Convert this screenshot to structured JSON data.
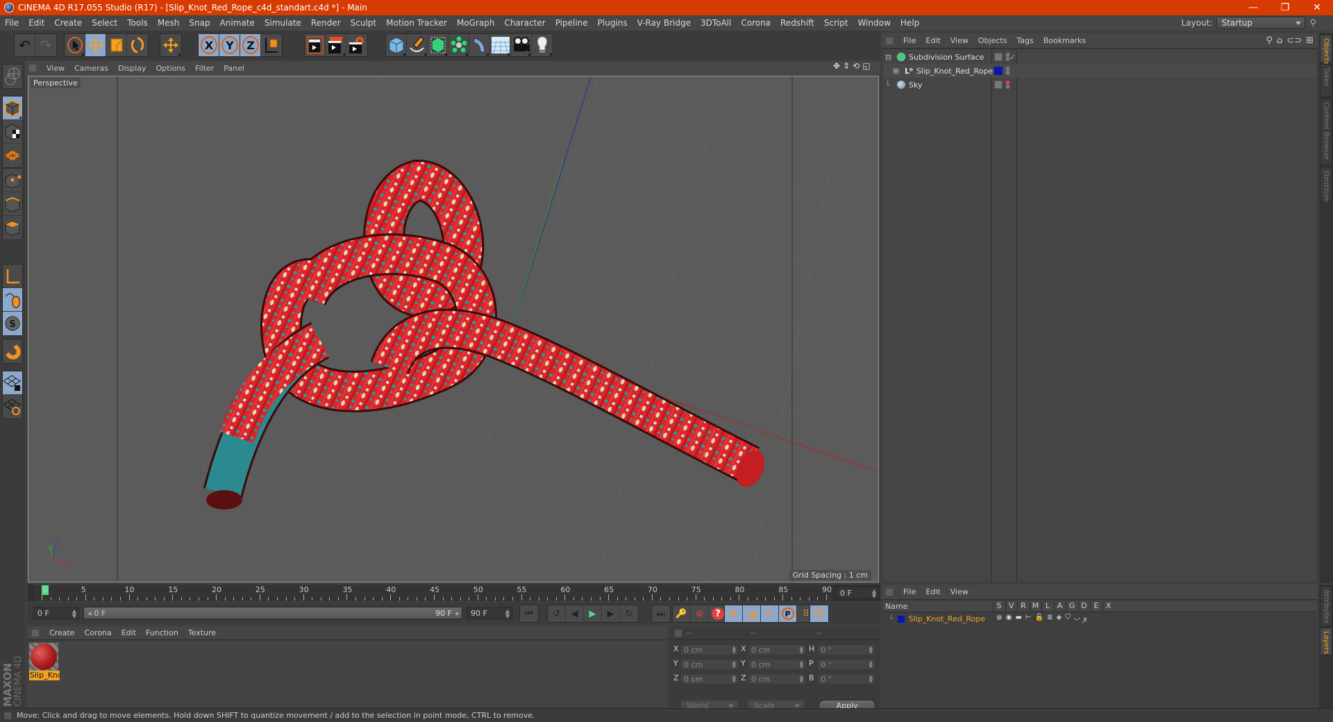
{
  "window": {
    "title": "CINEMA 4D R17.055 Studio (R17) - [Slip_Knot_Red_Rope_c4d_standart.c4d *] - Main",
    "controls": {
      "minimize": "—",
      "restore": "❐",
      "close": "✕"
    },
    "accent": "#d83b01"
  },
  "menubar": {
    "items": [
      "File",
      "Edit",
      "Create",
      "Select",
      "Tools",
      "Mesh",
      "Snap",
      "Animate",
      "Simulate",
      "Render",
      "Sculpt",
      "Motion Tracker",
      "MoGraph",
      "Character",
      "Pipeline",
      "Plugins",
      "V-Ray Bridge",
      "3DToAll",
      "Corona",
      "Redshift",
      "Script",
      "Window",
      "Help"
    ],
    "layout_label": "Layout:",
    "layout_value": "Startup"
  },
  "toolbar": {
    "groups": [
      {
        "name": "history",
        "buttons": [
          {
            "icon": "undo-icon",
            "glyph": "↶"
          },
          {
            "icon": "redo-icon",
            "glyph": "↷"
          }
        ]
      },
      {
        "name": "transform",
        "buttons": [
          {
            "icon": "select-icon",
            "glyph": "➚"
          },
          {
            "icon": "move-icon",
            "glyph": "✥",
            "active": true
          },
          {
            "icon": "scale-icon",
            "glyph": "◪"
          },
          {
            "icon": "rotate-icon",
            "glyph": "⟳"
          }
        ]
      },
      {
        "name": "last-tool",
        "buttons": [
          {
            "icon": "move-last-icon",
            "glyph": "✥"
          }
        ]
      },
      {
        "name": "axis",
        "buttons": [
          {
            "icon": "x-axis-icon",
            "glyph": "X",
            "active": true
          },
          {
            "icon": "y-axis-icon",
            "glyph": "Y",
            "active": true
          },
          {
            "icon": "z-axis-icon",
            "glyph": "Z",
            "active": true
          },
          {
            "icon": "coordinate-system-icon",
            "glyph": "⌊"
          }
        ]
      },
      {
        "name": "render",
        "buttons": [
          {
            "icon": "render-view-icon",
            "glyph": "🎬"
          },
          {
            "icon": "render-picture-viewer-icon",
            "glyph": "🎬"
          },
          {
            "icon": "render-settings-icon",
            "glyph": "⚙"
          }
        ]
      },
      {
        "name": "objects",
        "buttons": [
          {
            "icon": "cube-icon",
            "glyph": "⬛"
          },
          {
            "icon": "pen-spline-icon",
            "glyph": "✒"
          },
          {
            "icon": "subdivision-icon",
            "glyph": "⬢"
          },
          {
            "icon": "cloner-icon",
            "glyph": "✿"
          },
          {
            "icon": "deformer-icon",
            "glyph": "◗"
          },
          {
            "icon": "floor-icon",
            "glyph": "▦"
          },
          {
            "icon": "camera-icon",
            "glyph": "🎥"
          },
          {
            "icon": "light-icon",
            "glyph": "💡"
          }
        ]
      }
    ]
  },
  "left_tools": [
    {
      "icon": "make-editable-icon"
    },
    {
      "icon": "model-mode-icon",
      "active": true
    },
    {
      "icon": "texture-mode-icon"
    },
    {
      "icon": "workplane-mode-icon"
    },
    {
      "icon": "points-mode-icon"
    },
    {
      "icon": "edges-mode-icon"
    },
    {
      "icon": "polygons-mode-icon"
    },
    {
      "icon": "axis-mode-icon"
    },
    {
      "icon": "tweak-mode-icon",
      "active": true
    },
    {
      "icon": "solo-icon",
      "active": true
    },
    {
      "icon": "snap-magnet-icon"
    },
    {
      "icon": "locked-workplane-icon",
      "active": true
    },
    {
      "icon": "planar-workplane-icon"
    }
  ],
  "viewport": {
    "menu": [
      "View",
      "Cameras",
      "Display",
      "Options",
      "Filter",
      "Panel"
    ],
    "camera_label": "Perspective",
    "grid_spacing": "Grid Spacing : 1 cm",
    "axis_labels": {
      "x": "X",
      "y": "Y",
      "z": "Z"
    },
    "nav_icons": [
      "move-view-icon",
      "dolly-view-icon",
      "rotate-view-icon",
      "toggle-layout-icon"
    ]
  },
  "timeline": {
    "ticks": [
      "0",
      "5",
      "10",
      "15",
      "20",
      "25",
      "30",
      "35",
      "40",
      "45",
      "50",
      "55",
      "60",
      "65",
      "70",
      "75",
      "80",
      "85",
      "90"
    ],
    "current_frame_field": "0 F",
    "start_field": "0 F",
    "range_start": "0 F",
    "range_end": "90 F",
    "end_field": "90 F",
    "current_frame": 0,
    "max_frame": 90
  },
  "playback": {
    "buttons": [
      {
        "icon": "go-to-start-icon",
        "glyph": "⏮"
      },
      {
        "icon": "previous-key-icon",
        "glyph": "↺"
      },
      {
        "icon": "previous-frame-icon",
        "glyph": "◀"
      },
      {
        "icon": "play-icon",
        "glyph": "▶"
      },
      {
        "icon": "next-frame-icon",
        "glyph": "▶"
      },
      {
        "icon": "next-key-icon",
        "glyph": "↻"
      },
      {
        "icon": "go-to-end-icon",
        "glyph": "⏭"
      },
      {
        "icon": "record-keys-disabled-icon",
        "glyph": "🔑"
      },
      {
        "icon": "autokeying-icon",
        "glyph": "⦾"
      },
      {
        "icon": "keyframe-selection-icon",
        "glyph": "?"
      },
      {
        "icon": "key-position-icon",
        "glyph": "✥"
      },
      {
        "icon": "key-scale-icon",
        "glyph": "◪"
      },
      {
        "icon": "key-rotation-icon",
        "glyph": "⟳"
      },
      {
        "icon": "key-parameter-icon",
        "glyph": "P"
      },
      {
        "icon": "key-point-level-icon",
        "glyph": "⠿"
      },
      {
        "icon": "timeline-window-icon",
        "glyph": "🎞"
      }
    ]
  },
  "materials": {
    "menu": [
      "Create",
      "Corona",
      "Edit",
      "Function",
      "Texture"
    ],
    "items": [
      {
        "name": "Slip_Knc",
        "full_name": "Slip_Knot_Red_Rope"
      }
    ]
  },
  "coordinates": {
    "headers": [
      "--",
      "--",
      "--"
    ],
    "rows": [
      {
        "pos_label": "X",
        "pos": "0 cm",
        "size_label": "X",
        "size": "0 cm",
        "rot_label": "H",
        "rot": "0 °"
      },
      {
        "pos_label": "Y",
        "pos": "0 cm",
        "size_label": "Y",
        "size": "0 cm",
        "rot_label": "P",
        "rot": "0 °"
      },
      {
        "pos_label": "Z",
        "pos": "0 cm",
        "size_label": "Z",
        "size": "0 cm",
        "rot_label": "B",
        "rot": "0 °"
      }
    ],
    "space_select": "World",
    "mode_select": "Scale",
    "apply_label": "Apply"
  },
  "objects_panel": {
    "menu": [
      "File",
      "Edit",
      "View",
      "Objects",
      "Tags",
      "Bookmarks"
    ],
    "tree": [
      {
        "name": "Subdivision Surface",
        "icon": "subdivision-surface-icon",
        "depth": 0,
        "expand": "⊟",
        "check": "✓"
      },
      {
        "name": "Slip_Knot_Red_Rope",
        "icon": "null-object-icon",
        "depth": 1,
        "expand": "⊞",
        "layer_color": "#0a14b4"
      },
      {
        "name": "Sky",
        "icon": "sky-icon",
        "depth": 0
      }
    ]
  },
  "right_tabs": [
    "Objects",
    "Takes",
    "Content Browser",
    "Structure"
  ],
  "right_tabs_bottom": [
    "Attributes",
    "Layers"
  ],
  "layers_panel": {
    "menu": [
      "File",
      "Edit",
      "View"
    ],
    "columns": [
      "Name",
      "S",
      "V",
      "R",
      "M",
      "L",
      "A",
      "G",
      "D",
      "E",
      "X"
    ],
    "rows": [
      {
        "name": "Slip_Knot_Red_Rope",
        "color": "#0a14b4"
      }
    ]
  },
  "status": {
    "message": "Move: Click and drag to move elements. Hold down SHIFT to quantize movement / add to the selection in point mode, CTRL to remove."
  },
  "branding": {
    "maxon": "MAXON",
    "product": "CINEMA 4D"
  },
  "colors": {
    "rope_red": "#d8262a",
    "rope_teal": "#1b9fa6",
    "rope_cream": "#e8d8b0",
    "active_button": "#8ea8cc",
    "highlight_orange": "#f3a320"
  }
}
